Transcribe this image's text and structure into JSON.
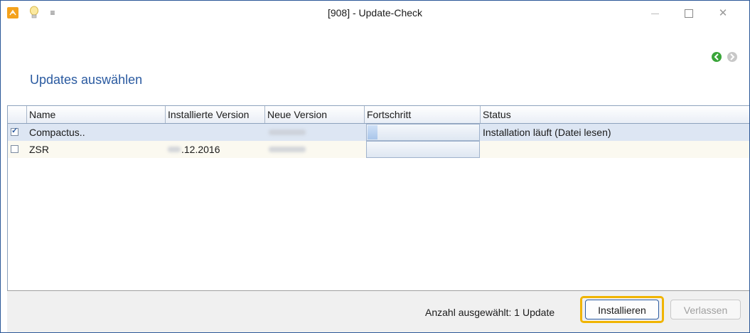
{
  "window": {
    "title": "[908] - Update-Check",
    "controls": {
      "minimize": "minimize-icon",
      "maximize": "maximize-icon",
      "close": "✕"
    }
  },
  "colors": {
    "accent": "#2a5aa0",
    "highlight": "#f0b400",
    "app_icon": "#f4a21c"
  },
  "page": {
    "title": "Updates auswählen"
  },
  "table": {
    "columns": [
      "Name",
      "Installierte Version",
      "Neue Version",
      "Fortschritt",
      "Status"
    ],
    "rows": [
      {
        "checked": true,
        "name": "Compactus..",
        "installed": "",
        "new_version": "",
        "progress": 0.09,
        "status": "Installation läuft (Datei lesen)"
      },
      {
        "checked": false,
        "name": "ZSR",
        "installed": ".12.2016",
        "new_version": "",
        "progress": 0,
        "status": ""
      }
    ]
  },
  "footer": {
    "count_label": "Anzahl ausgewählt: 1 Update",
    "install_button": "Installieren",
    "leave_button": "Verlassen"
  }
}
